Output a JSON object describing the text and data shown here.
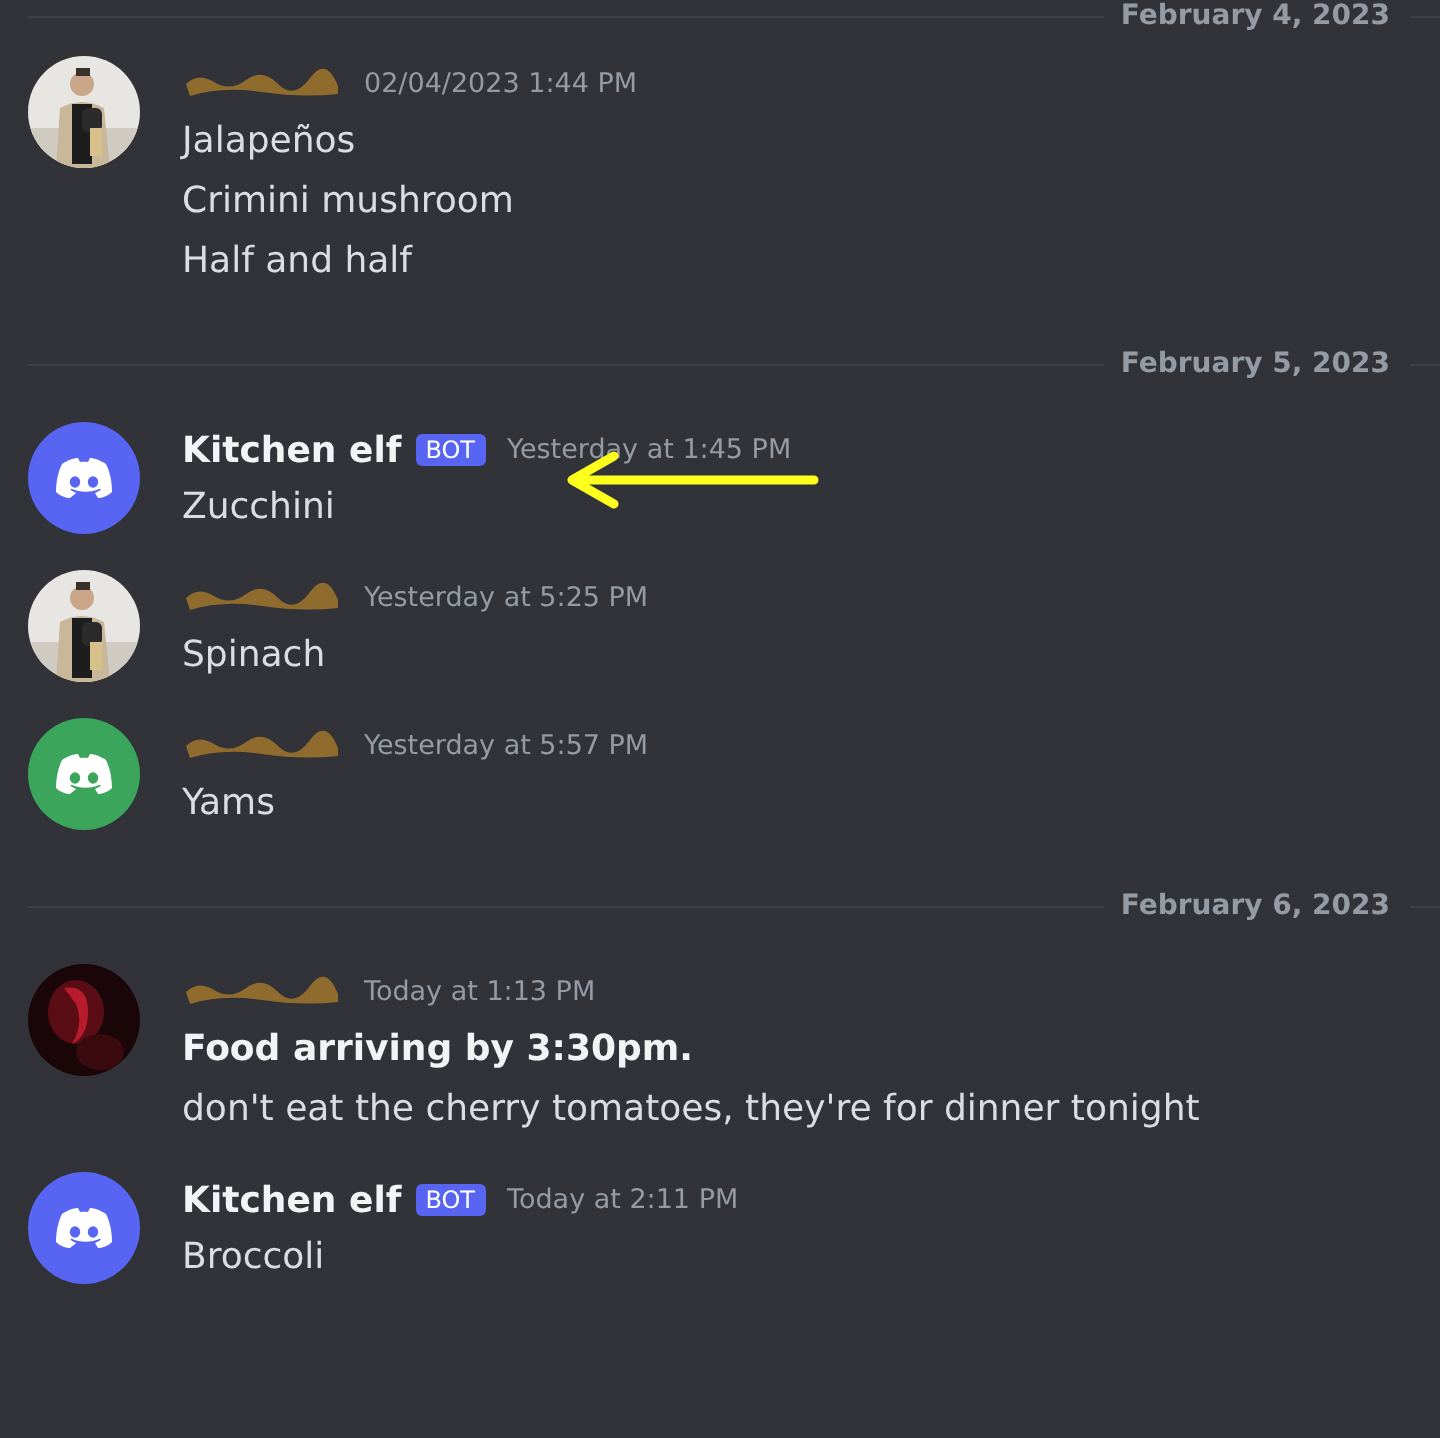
{
  "feed": [
    {
      "kind": "divider",
      "date": "February 4, 2023"
    },
    {
      "kind": "message",
      "avatar": {
        "kind": "photo-person"
      },
      "author_redacted": true,
      "time": "02/04/2023 1:44 PM",
      "lines": [
        {
          "text": "Jalapeños",
          "bold": false
        },
        {
          "text": "Crimini mushroom",
          "bold": false
        },
        {
          "text": "Half and half",
          "bold": false
        }
      ]
    },
    {
      "kind": "divider",
      "date": "February 5, 2023"
    },
    {
      "kind": "message",
      "avatar": {
        "kind": "logo",
        "color": "#5865f2"
      },
      "author": "Kitchen elf",
      "badge": "BOT",
      "time": "Yesterday at 1:45 PM",
      "arrow": true,
      "lines": [
        {
          "text": "Zucchini",
          "bold": false
        }
      ]
    },
    {
      "kind": "message",
      "avatar": {
        "kind": "photo-person"
      },
      "author_redacted": true,
      "time": "Yesterday at 5:25 PM",
      "lines": [
        {
          "text": "Spinach",
          "bold": false
        }
      ]
    },
    {
      "kind": "message",
      "avatar": {
        "kind": "logo",
        "color": "#3ba55c"
      },
      "author_redacted": true,
      "time": "Yesterday at 5:57 PM",
      "lines": [
        {
          "text": "Yams",
          "bold": false
        }
      ]
    },
    {
      "kind": "divider",
      "date": "February 6, 2023"
    },
    {
      "kind": "message",
      "avatar": {
        "kind": "photo-red"
      },
      "author_redacted": true,
      "time": "Today at 1:13 PM",
      "lines": [
        {
          "text": "Food arriving by 3:30pm.",
          "bold": true
        },
        {
          "text": "don't eat the cherry tomatoes, they're for dinner tonight",
          "bold": false
        }
      ]
    },
    {
      "kind": "message",
      "avatar": {
        "kind": "logo",
        "color": "#5865f2"
      },
      "author": "Kitchen elf",
      "badge": "BOT",
      "time": "Today at 2:11 PM",
      "lines": [
        {
          "text": "Broccoli",
          "bold": false
        }
      ]
    }
  ]
}
